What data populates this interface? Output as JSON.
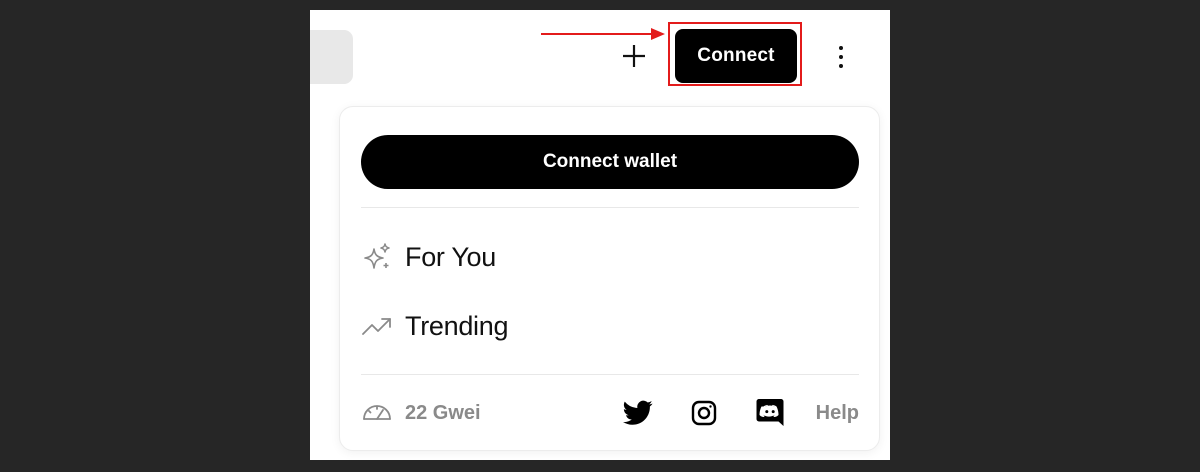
{
  "header": {
    "connect_label": "Connect",
    "plus_icon": "plus-icon",
    "more_icon": "more-vertical-icon",
    "annotation_color": "#e31b1b"
  },
  "menu": {
    "connect_wallet_label": "Connect wallet",
    "items": [
      {
        "label": "For You",
        "icon": "sparkles-icon"
      },
      {
        "label": "Trending",
        "icon": "trending-up-icon"
      }
    ],
    "footer": {
      "gas_label": "22 Gwei",
      "gas_icon": "gauge-icon",
      "social": [
        {
          "name": "Twitter",
          "icon": "twitter-icon"
        },
        {
          "name": "Instagram",
          "icon": "instagram-icon"
        },
        {
          "name": "Discord",
          "icon": "discord-icon"
        }
      ],
      "help_label": "Help"
    }
  }
}
